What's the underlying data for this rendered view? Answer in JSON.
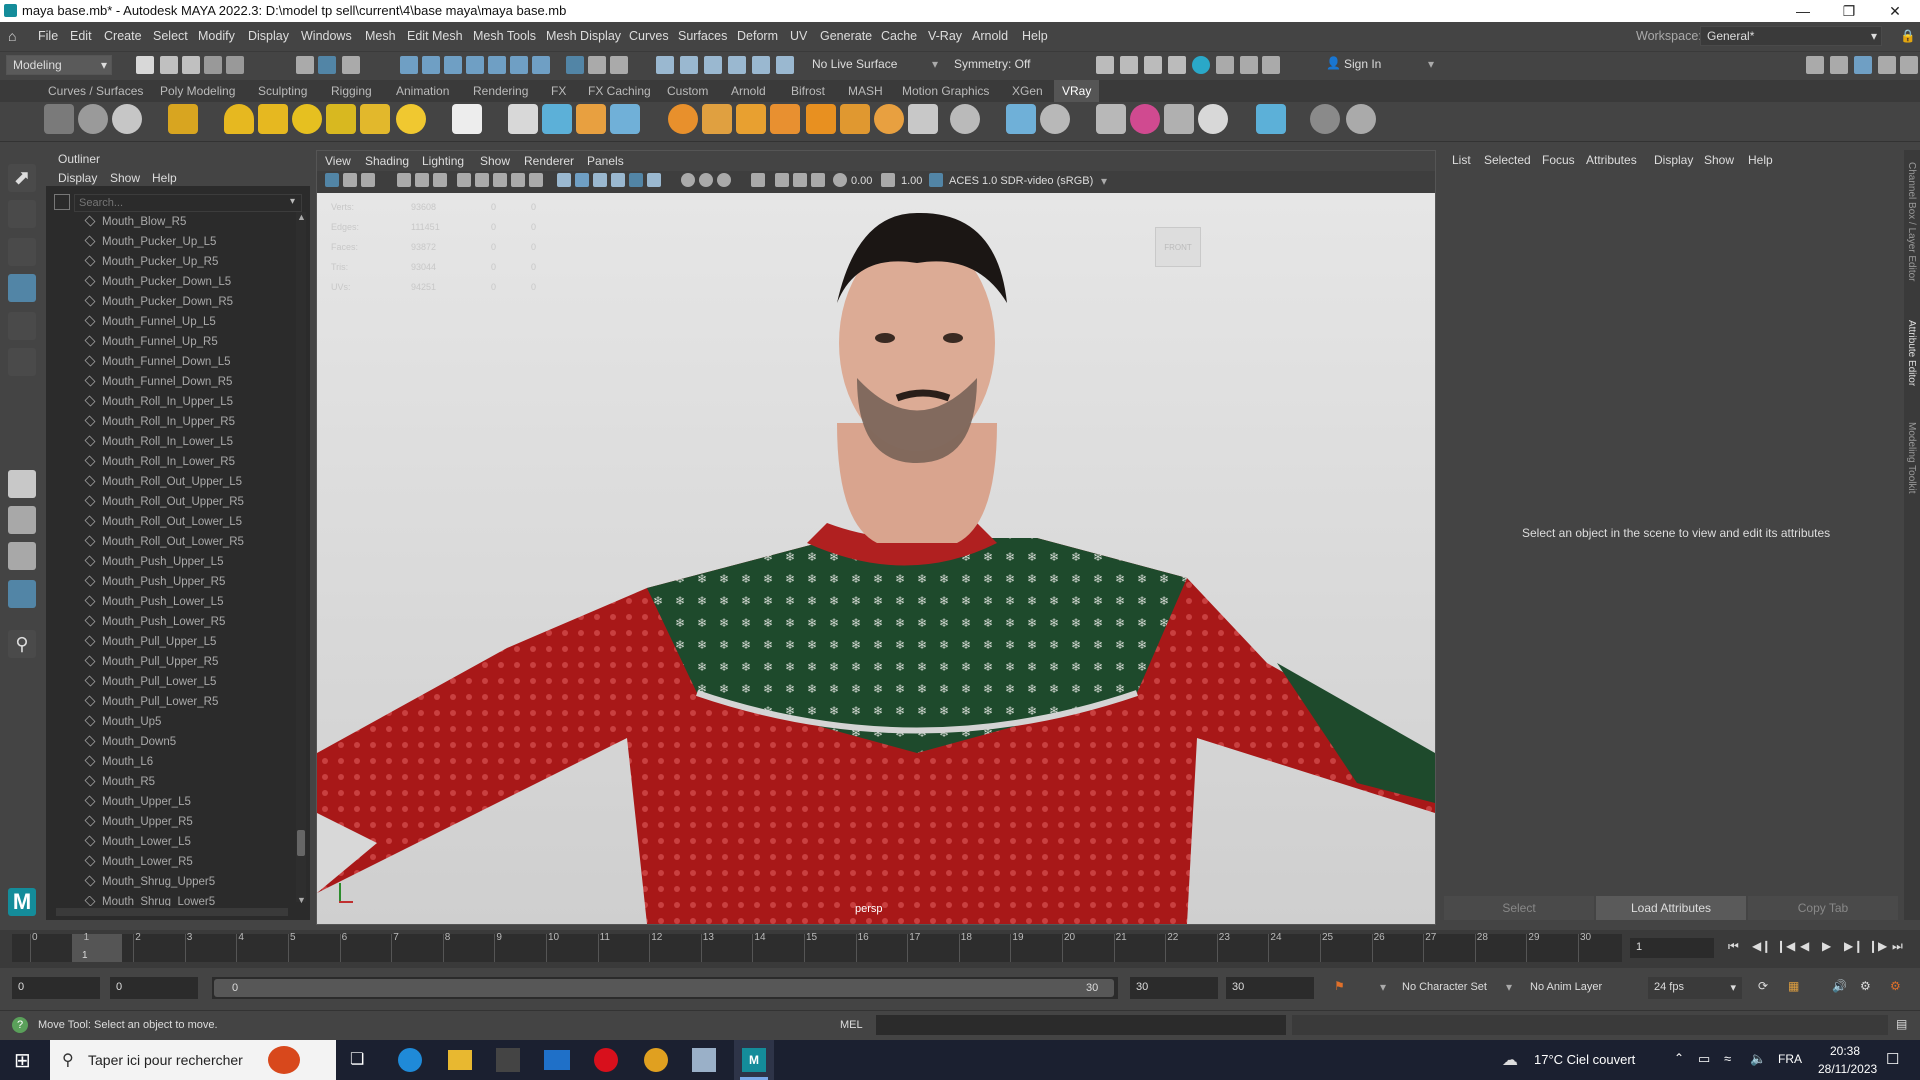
{
  "window": {
    "title": "maya base.mb* - Autodesk MAYA 2022.3: D:\\model tp sell\\current\\4\\base maya\\maya base.mb"
  },
  "menubar": {
    "items": [
      "File",
      "Edit",
      "Create",
      "Select",
      "Modify",
      "Display",
      "Windows",
      "Mesh",
      "Edit Mesh",
      "Mesh Tools",
      "Mesh Display",
      "Curves",
      "Surfaces",
      "Deform",
      "UV",
      "Generate",
      "Cache",
      "V-Ray",
      "Arnold",
      "Help"
    ],
    "workspace_label": "Workspace:",
    "workspace_value": "General*"
  },
  "statusline": {
    "mode": "Modeling",
    "live_surface": "No Live Surface",
    "symmetry": "Symmetry: Off",
    "sign_in": "Sign In"
  },
  "shelf_tabs": [
    "Curves / Surfaces",
    "Poly Modeling",
    "Sculpting",
    "Rigging",
    "Animation",
    "Rendering",
    "FX",
    "FX Caching",
    "Custom",
    "Arnold",
    "Bifrost",
    "MASH",
    "Motion Graphics",
    "XGen",
    "VRay"
  ],
  "shelf_active": "VRay",
  "outliner": {
    "title": "Outliner",
    "menu": [
      "Display",
      "Show",
      "Help"
    ],
    "search_placeholder": "Search...",
    "items": [
      "Mouth_Blow_R5",
      "Mouth_Pucker_Up_L5",
      "Mouth_Pucker_Up_R5",
      "Mouth_Pucker_Down_L5",
      "Mouth_Pucker_Down_R5",
      "Mouth_Funnel_Up_L5",
      "Mouth_Funnel_Up_R5",
      "Mouth_Funnel_Down_L5",
      "Mouth_Funnel_Down_R5",
      "Mouth_Roll_In_Upper_L5",
      "Mouth_Roll_In_Upper_R5",
      "Mouth_Roll_In_Lower_L5",
      "Mouth_Roll_In_Lower_R5",
      "Mouth_Roll_Out_Upper_L5",
      "Mouth_Roll_Out_Upper_R5",
      "Mouth_Roll_Out_Lower_L5",
      "Mouth_Roll_Out_Lower_R5",
      "Mouth_Push_Upper_L5",
      "Mouth_Push_Upper_R5",
      "Mouth_Push_Lower_L5",
      "Mouth_Push_Lower_R5",
      "Mouth_Pull_Upper_L5",
      "Mouth_Pull_Upper_R5",
      "Mouth_Pull_Lower_L5",
      "Mouth_Pull_Lower_R5",
      "Mouth_Up5",
      "Mouth_Down5",
      "Mouth_L6",
      "Mouth_R5",
      "Mouth_Upper_L5",
      "Mouth_Upper_R5",
      "Mouth_Lower_L5",
      "Mouth_Lower_R5",
      "Mouth_Shrug_Upper5",
      "Mouth_Shrug_Lower5"
    ]
  },
  "viewport": {
    "menu": [
      "View",
      "Shading",
      "Lighting",
      "Show",
      "Renderer",
      "Panels"
    ],
    "field_a": "0.00",
    "field_b": "1.00",
    "colorspace": "ACES 1.0 SDR-video (sRGB)",
    "camera": "persp",
    "hud_labels": [
      "Verts:",
      "Edges:",
      "Faces:",
      "Tris:",
      "UVs:"
    ],
    "hud_values": [
      "93608",
      "111451",
      "93872",
      "93044",
      "94251"
    ],
    "hud_zeros": [
      "0",
      "0",
      "0",
      "0",
      "0"
    ],
    "viewcube": "FRONT"
  },
  "attribute_editor": {
    "menu": [
      "List",
      "Selected",
      "Focus",
      "Attributes",
      "Display",
      "Show",
      "Help"
    ],
    "message": "Select an object in the scene to view and edit its attributes",
    "buttons": [
      "Select",
      "Load Attributes",
      "Copy Tab"
    ]
  },
  "side_tabs": [
    "Channel Box / Layer Editor",
    "Attribute Editor",
    "Modeling Toolkit"
  ],
  "timeline": {
    "ticks": [
      "0",
      "1",
      "2",
      "3",
      "4",
      "5",
      "6",
      "7",
      "8",
      "9",
      "10",
      "11",
      "12",
      "13",
      "14",
      "15",
      "16",
      "17",
      "18",
      "19",
      "20",
      "21",
      "22",
      "23",
      "24",
      "25",
      "26",
      "27",
      "28",
      "29",
      "30"
    ],
    "current_marker": "1",
    "current_frame": "1"
  },
  "range": {
    "start": "0",
    "anim_start": "0",
    "slider_start": "0",
    "slider_end": "30",
    "anim_end": "30",
    "end": "30",
    "character_set": "No Character Set",
    "anim_layer": "No Anim Layer",
    "fps": "24 fps"
  },
  "help_line": {
    "message": "Move Tool: Select an object to move.",
    "mel_label": "MEL"
  },
  "taskbar": {
    "search_placeholder": "Taper ici pour rechercher",
    "weather": "17°C  Ciel couvert",
    "lang": "FRA",
    "time": "20:38",
    "date": "28/11/2023"
  },
  "colors": {
    "accent": "#5285a6",
    "maya_blue": "#148c9a",
    "sweater_red": "#a81818",
    "sweater_green": "#1e4a2c"
  }
}
